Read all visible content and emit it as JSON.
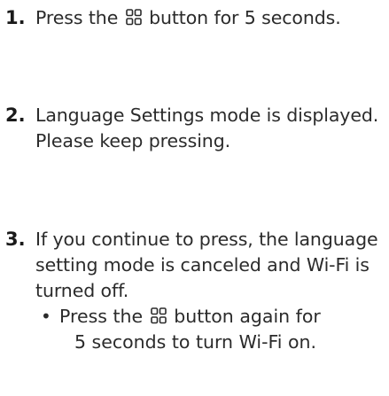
{
  "steps": [
    {
      "number": "1.",
      "lines": [
        {
          "before": "Press the",
          "icon": "four-squares-button-icon",
          "after": "button for 5 seconds."
        }
      ]
    },
    {
      "number": "2.",
      "lines": [
        "Language Settings mode is displayed.",
        "Please keep pressing."
      ]
    },
    {
      "number": "3.",
      "lines": [
        "If you continue to press, the language",
        "setting mode is canceled and Wi-Fi is",
        "turned off."
      ],
      "bullet": {
        "symbol": "•",
        "line1_before": "Press the",
        "icon": "four-squares-button-icon",
        "line1_after": "button again for",
        "line2": "5 seconds to turn Wi-Fi on."
      }
    }
  ]
}
